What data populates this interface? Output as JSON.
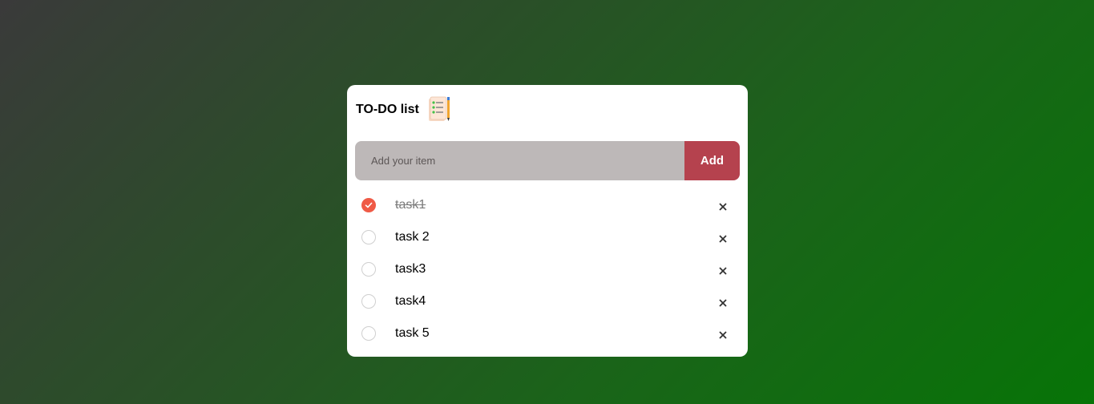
{
  "app": {
    "title": "TO-DO list",
    "logo_icon": "notepad-checklist-icon"
  },
  "input": {
    "placeholder": "Add your item",
    "value": "",
    "add_label": "Add"
  },
  "colors": {
    "accent": "#b5424e",
    "checked": "#ef5a46",
    "input_bg": "#bdb8b8"
  },
  "tasks": [
    {
      "label": "task1",
      "done": true
    },
    {
      "label": "task 2",
      "done": false
    },
    {
      "label": "task3",
      "done": false
    },
    {
      "label": "task4",
      "done": false
    },
    {
      "label": "task 5",
      "done": false
    }
  ],
  "icons": {
    "check": "checkmark-icon",
    "delete": "close-icon"
  }
}
